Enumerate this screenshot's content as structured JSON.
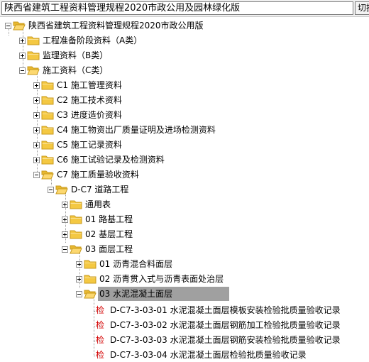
{
  "combo": {
    "value": "陕西省建筑工程资料管理规程2020市政公用及园林绿化版"
  },
  "switch_button": {
    "label": "切换"
  },
  "tree": {
    "root": "陕西省建筑工程资料管理规程2020市政公用版",
    "a": "工程准备阶段资料（A类）",
    "b": "监理资料（B类）",
    "c": "施工资料（C类）",
    "c1": "C1 施工管理资料",
    "c2": "C2 施工技术资料",
    "c3": "C3 进度造价资料",
    "c4": "C4 施工物资出厂质量证明及进场检测资料",
    "c5": "C5 施工记录资料",
    "c6": "C6 施工试验记录及检测资料",
    "c7": "C7 施工质量验收资料",
    "dc7": "D-C7 道路工程",
    "general": "通用表",
    "n01": "01 路基工程",
    "n02": "02 基层工程",
    "n03": "03 面层工程",
    "s01": "01 沥青混合料面层",
    "s02": "02 沥青贯入式与沥青表面处治层",
    "s03": "03 水泥混凝土面层",
    "check_label": "检",
    "leaf1": "D-C7-3-03-01 水泥混凝土面层模板安装检验批质量验收记录",
    "leaf2": "D-C7-3-03-02 水泥混凝土面层钢筋加工检验批质量验收记录",
    "leaf3": "D-C7-3-03-03 水泥混凝土面层钢筋安装检验批质量验收记录",
    "leaf4": "D-C7-3-03-04 水泥混凝土面层检验批质量验收记录"
  },
  "colors": {
    "folder": "#f4c842",
    "selection": "#a0a0a0",
    "check": "#d40000"
  }
}
